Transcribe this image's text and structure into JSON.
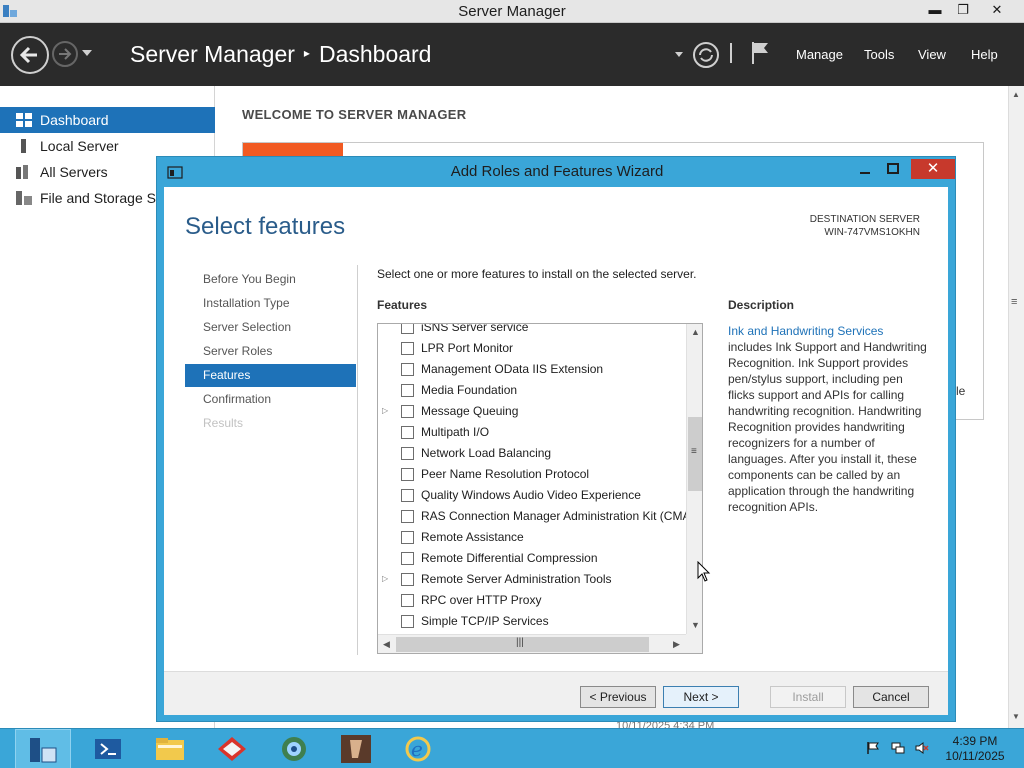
{
  "titlebar": {
    "title": "Server Manager",
    "minimize": "▬",
    "restore": "❐",
    "close": "✕"
  },
  "header": {
    "app_name": "Server Manager",
    "separator": "▸",
    "page": "Dashboard",
    "menu": [
      "Manage",
      "Tools",
      "View",
      "Help"
    ]
  },
  "sidebar": {
    "items": [
      {
        "label": "Dashboard",
        "icon": "dashboard-icon",
        "active": true
      },
      {
        "label": "Local Server",
        "icon": "server-icon"
      },
      {
        "label": "All Servers",
        "icon": "servers-icon"
      },
      {
        "label": "File and Storage Services",
        "icon": "storage-icon"
      }
    ]
  },
  "main": {
    "welcome": "WELCOME TO SERVER MANAGER",
    "behind_fragment": "le",
    "behind_date": "10/11/2025 4:34 PM"
  },
  "wizard": {
    "title": "Add Roles and Features Wizard",
    "heading": "Select features",
    "destination_label": "DESTINATION SERVER",
    "destination_server": "WIN-747VMS1OKHN",
    "steps": [
      {
        "label": "Before You Begin",
        "state": "normal"
      },
      {
        "label": "Installation Type",
        "state": "normal"
      },
      {
        "label": "Server Selection",
        "state": "normal"
      },
      {
        "label": "Server Roles",
        "state": "normal"
      },
      {
        "label": "Features",
        "state": "active"
      },
      {
        "label": "Confirmation",
        "state": "normal"
      },
      {
        "label": "Results",
        "state": "disabled"
      }
    ],
    "instruction": "Select one or more features to install on the selected server.",
    "features_header": "Features",
    "description_header": "Description",
    "features": [
      {
        "name": "iSNS Server service",
        "expandable": false
      },
      {
        "name": "LPR Port Monitor",
        "expandable": false
      },
      {
        "name": "Management OData IIS Extension",
        "expandable": false
      },
      {
        "name": "Media Foundation",
        "expandable": false
      },
      {
        "name": "Message Queuing",
        "expandable": true
      },
      {
        "name": "Multipath I/O",
        "expandable": false
      },
      {
        "name": "Network Load Balancing",
        "expandable": false
      },
      {
        "name": "Peer Name Resolution Protocol",
        "expandable": false
      },
      {
        "name": "Quality Windows Audio Video Experience",
        "expandable": false
      },
      {
        "name": "RAS Connection Manager Administration Kit (CMAK)",
        "expandable": false
      },
      {
        "name": "Remote Assistance",
        "expandable": false
      },
      {
        "name": "Remote Differential Compression",
        "expandable": false
      },
      {
        "name": "Remote Server Administration Tools",
        "expandable": true
      },
      {
        "name": "RPC over HTTP Proxy",
        "expandable": false
      },
      {
        "name": "Simple TCP/IP Services",
        "expandable": false
      }
    ],
    "description_link": "Ink and Handwriting Services",
    "description_text": "includes Ink Support and Handwriting Recognition. Ink Support provides pen/stylus support, including pen flicks support and APIs for calling handwriting recognition. Handwriting Recognition provides handwriting recognizers for a number of languages. After you install it, these components can be called by an application through the handwriting recognition APIs.",
    "buttons": {
      "previous": "< Previous",
      "next": "Next >",
      "install": "Install",
      "cancel": "Cancel"
    }
  },
  "taskbar": {
    "apps": [
      "server-manager",
      "powershell",
      "file-explorer",
      "toolbox",
      "network-globe",
      "media-app",
      "internet-explorer"
    ],
    "time": "4:39 PM",
    "date": "10/11/2025"
  },
  "colors": {
    "accent": "#1e72b8",
    "wizard_frame": "#3aa6d8",
    "header": "#2b2b2b",
    "close": "#c7392c",
    "welcome_orange": "#f15a22"
  }
}
